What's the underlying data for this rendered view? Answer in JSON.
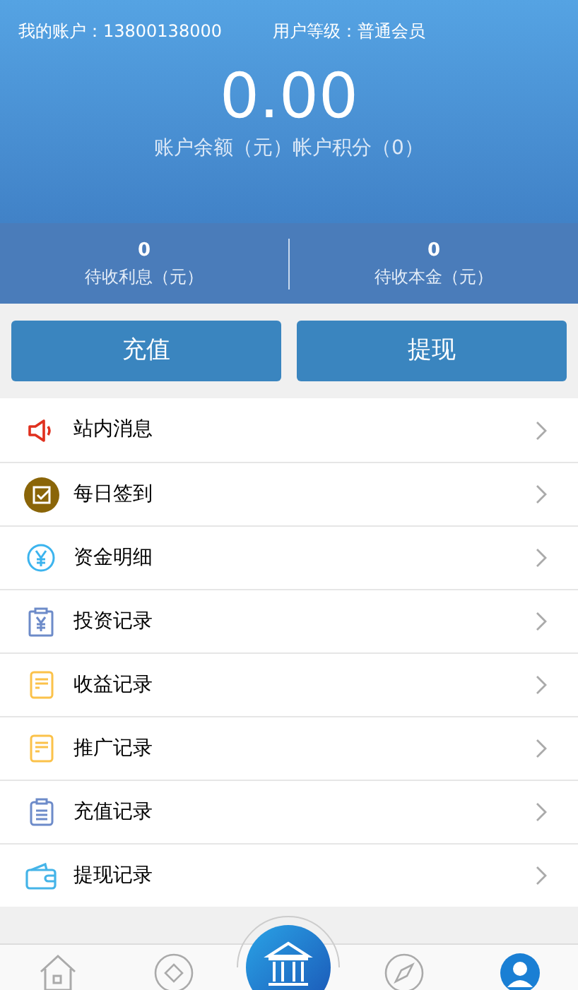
{
  "header": {
    "account_label": "我的账户：",
    "account": "13800138000",
    "level_label": "用户等级：",
    "level_value": "普通会员",
    "balance": "0.00",
    "balance_caption": "账户余额（元）帐户积分（0）"
  },
  "stats": [
    {
      "value": "0",
      "label": "待收利息（元）"
    },
    {
      "value": "0",
      "label": "待收本金（元）"
    }
  ],
  "buttons": [
    "充值",
    "提现"
  ],
  "menu": [
    {
      "kind": "speaker",
      "label": "站内消息"
    },
    {
      "kind": "checkin",
      "label": "每日签到"
    },
    {
      "kind": "yen",
      "label": "资金明细"
    },
    {
      "kind": "clipboard-yen",
      "label": "投资记录"
    },
    {
      "kind": "note",
      "label": "收益记录"
    },
    {
      "kind": "note",
      "label": "推广记录"
    },
    {
      "kind": "clipboard",
      "label": "充值记录"
    },
    {
      "kind": "wallet",
      "label": "提现记录"
    }
  ],
  "nav": [
    {
      "kind": "home",
      "selected": false
    },
    {
      "kind": "diamond",
      "selected": false
    },
    {
      "kind": "bank",
      "selected": false
    },
    {
      "kind": "compass",
      "selected": false
    },
    {
      "kind": "user",
      "selected": true
    }
  ]
}
